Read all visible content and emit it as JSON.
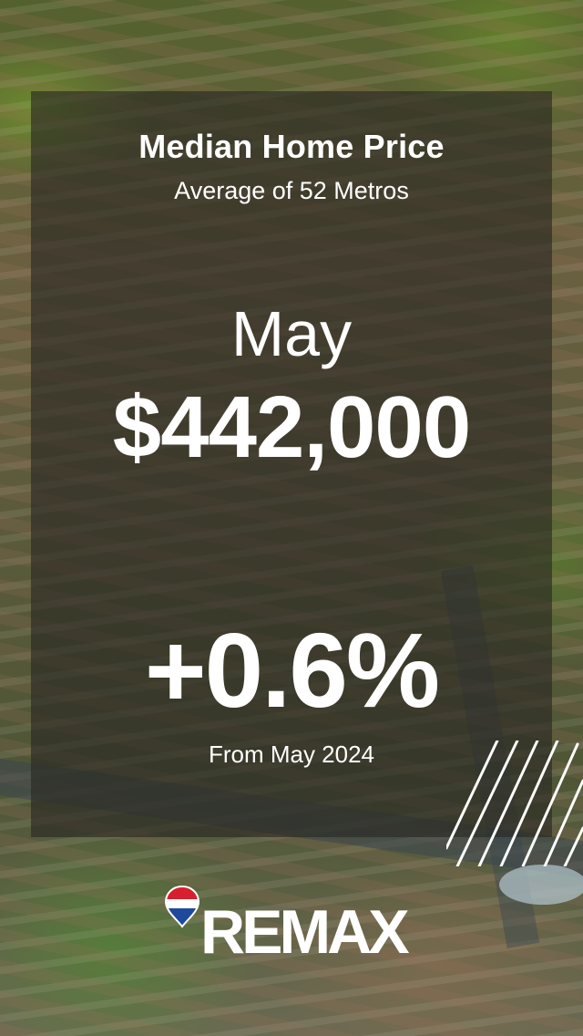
{
  "card": {
    "title": "Median Home Price",
    "subtitle": "Average of 52 Metros",
    "month": "May",
    "price": "$442,000",
    "change": "+0.6%",
    "comparison": "From May 2024"
  },
  "brand": {
    "name": "REMAX",
    "icon": "hot-air-balloon-icon",
    "colors": {
      "red": "#d6202f",
      "blue": "#1e4a9c",
      "white": "#ffffff"
    }
  }
}
